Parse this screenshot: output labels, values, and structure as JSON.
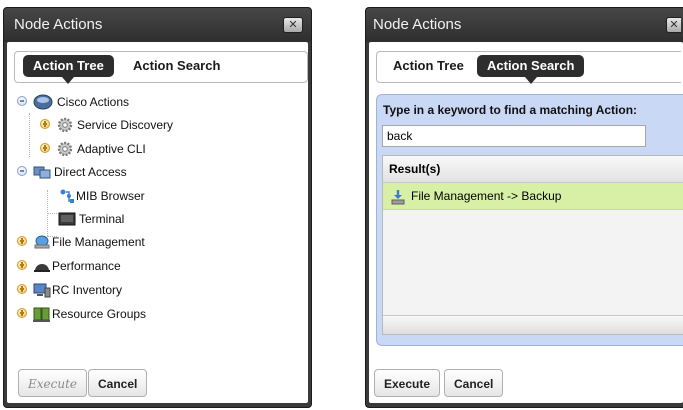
{
  "dialog_title": "Node Actions",
  "tabs": {
    "tree": "Action Tree",
    "search": "Action Search"
  },
  "tree": {
    "cisco_actions": "Cisco Actions",
    "service_discovery": "Service Discovery",
    "adaptive_cli": "Adaptive CLI",
    "direct_access": "Direct Access",
    "mib_browser": "MIB Browser",
    "terminal": "Terminal",
    "file_management": "File Management",
    "performance": "Performance",
    "rc_inventory": "RC Inventory",
    "resource_groups": "Resource Groups"
  },
  "buttons": {
    "execute": "Execute",
    "cancel": "Cancel"
  },
  "search": {
    "prompt": "Type in a keyword to find a matching Action:",
    "keyword": "back",
    "results_header": "Result(s)",
    "results": [
      "File Management -> Backup"
    ]
  },
  "colors": {
    "dialog_frame": "#3a3a3a",
    "active_tab": "#2d2d2d",
    "search_panel": "#c9d8f4",
    "result_highlight": "#d8f0a5"
  },
  "icons": {
    "close": "close-icon",
    "cisco": "cisco-globe-icon",
    "gear": "gear-icon",
    "direct_access": "terminal-screen-icon",
    "mib": "mib-browser-icon",
    "file": "file-drive-icon",
    "performance": "performance-dome-icon",
    "rc": "rc-inventory-icon",
    "resource": "resource-groups-icon",
    "backup": "backup-download-icon"
  }
}
